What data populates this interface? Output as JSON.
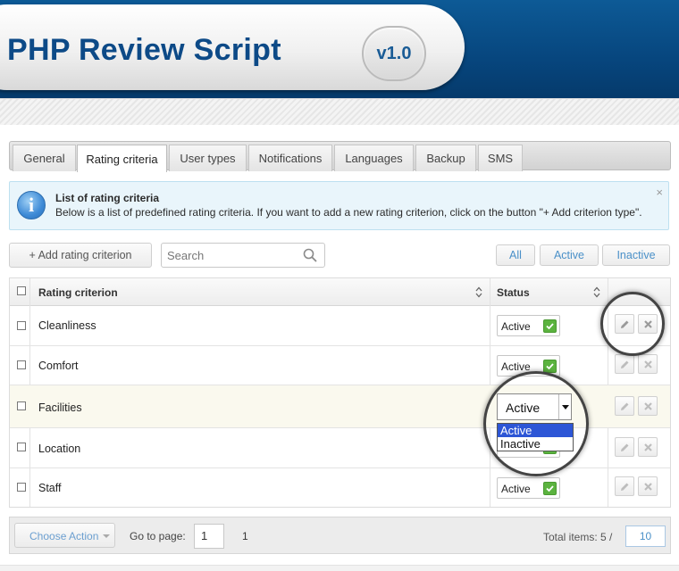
{
  "header": {
    "title": "PHP Review Script",
    "version": "v1.0"
  },
  "tabs": [
    {
      "label": "General"
    },
    {
      "label": "Rating criteria"
    },
    {
      "label": "User types"
    },
    {
      "label": "Notifications"
    },
    {
      "label": "Languages"
    },
    {
      "label": "Backup"
    },
    {
      "label": "SMS"
    }
  ],
  "active_tab": "Rating criteria",
  "info": {
    "title": "List of rating criteria",
    "text": "Below is a list of predefined rating criteria. If you want to add a new rating criterion, click on the button \"+ Add criterion type\".",
    "close": "×"
  },
  "toolbar": {
    "add_label": "+ Add rating criterion",
    "search_placeholder": "Search",
    "filters": [
      "All",
      "Active",
      "Inactive"
    ]
  },
  "table": {
    "columns": {
      "criterion": "Rating criterion",
      "status": "Status"
    },
    "rows": [
      {
        "name": "Cleanliness",
        "status": "Active"
      },
      {
        "name": "Comfort",
        "status": "Active"
      },
      {
        "name": "Facilities",
        "status": "Active"
      },
      {
        "name": "Location",
        "status": "Active"
      },
      {
        "name": "Staff",
        "status": "Active"
      }
    ]
  },
  "dropdown": {
    "options": [
      "Active",
      "Inactive"
    ],
    "selected": "Active"
  },
  "footer": {
    "choose_action": "Choose Action",
    "go_to_page": "Go to page:",
    "page_value": "1",
    "total_pages": "1",
    "total_items": "Total items: 5 /",
    "per_page": "10"
  },
  "colors": {
    "header_blue": "#07467e",
    "accent": "#4a90c8",
    "check_green": "#5bb33f",
    "selected_option": "#2d56d6"
  }
}
